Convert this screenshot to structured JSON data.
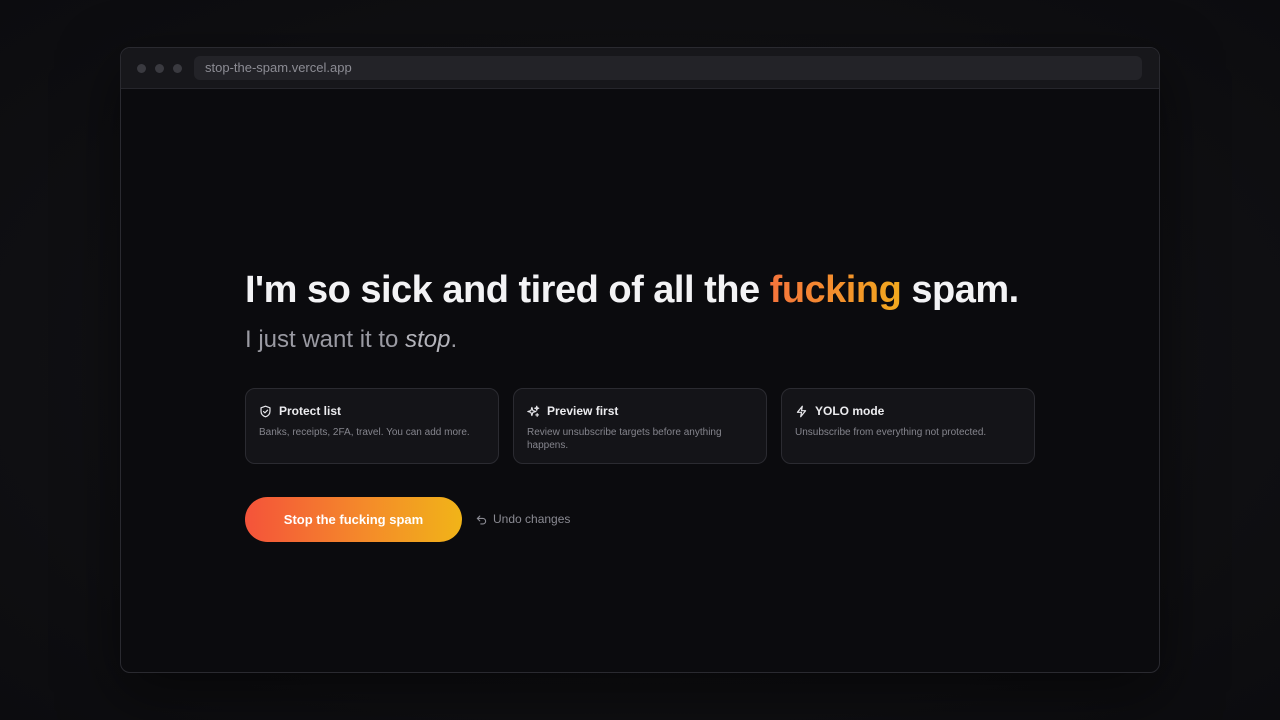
{
  "browser": {
    "url": "stop-the-spam.vercel.app"
  },
  "hero": {
    "headline_before": "I'm so sick and tired of all the ",
    "headline_accent": "fucking",
    "headline_after": " spam.",
    "sub_before": "I just want it to ",
    "sub_em": "stop",
    "sub_after": "."
  },
  "cards": [
    {
      "icon": "shield-check-icon",
      "title": "Protect list",
      "description": "Banks, receipts, 2FA, travel. You can add more."
    },
    {
      "icon": "sparkles-icon",
      "title": "Preview first",
      "description": "Review unsubscribe targets before anything happens."
    },
    {
      "icon": "lightning-icon",
      "title": "YOLO mode",
      "description": "Unsubscribe from everything not protected."
    }
  ],
  "actions": {
    "primary_label": "Stop the fucking spam",
    "undo_label": "Undo changes",
    "undo_icon": "undo-arrow-icon"
  },
  "colors": {
    "accent_start": "#f4533a",
    "accent_end": "#f1b418",
    "background": "#0b0b0e"
  }
}
